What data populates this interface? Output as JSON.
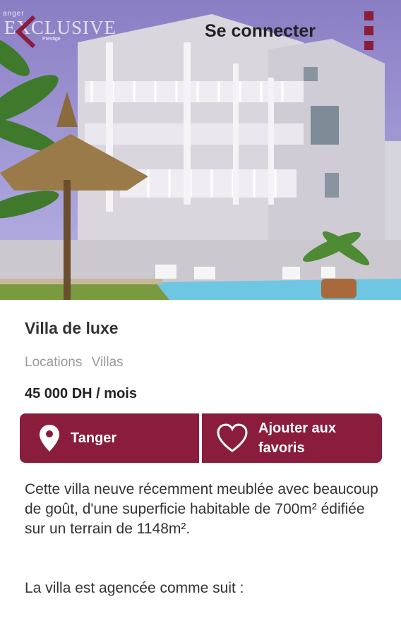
{
  "header": {
    "brand_top": "anger",
    "brand_main": "EXCLUSIVE",
    "brand_sub": "Prestige",
    "login_label": "Se connecter"
  },
  "listing": {
    "title": "Villa de luxe",
    "categories": [
      "Locations",
      "Villas"
    ],
    "price": "45 000 DH / mois",
    "location_label": "Tanger",
    "favorite_label_line1": "Ajouter aux",
    "favorite_label_line2": "favoris",
    "description": "Cette villa neuve récemment meublée avec beaucoup de goût, d'une superficie habitable de 700m² édifiée sur un terrain de 1148m².",
    "description_2": "La villa est agencée comme suit :"
  },
  "colors": {
    "accent": "#8a1c3c",
    "text": "#333333",
    "muted": "#999999"
  },
  "icons": {
    "back": "chevron-left-icon",
    "menu": "overflow-menu-icon",
    "location": "map-pin-icon",
    "favorite": "heart-icon"
  }
}
